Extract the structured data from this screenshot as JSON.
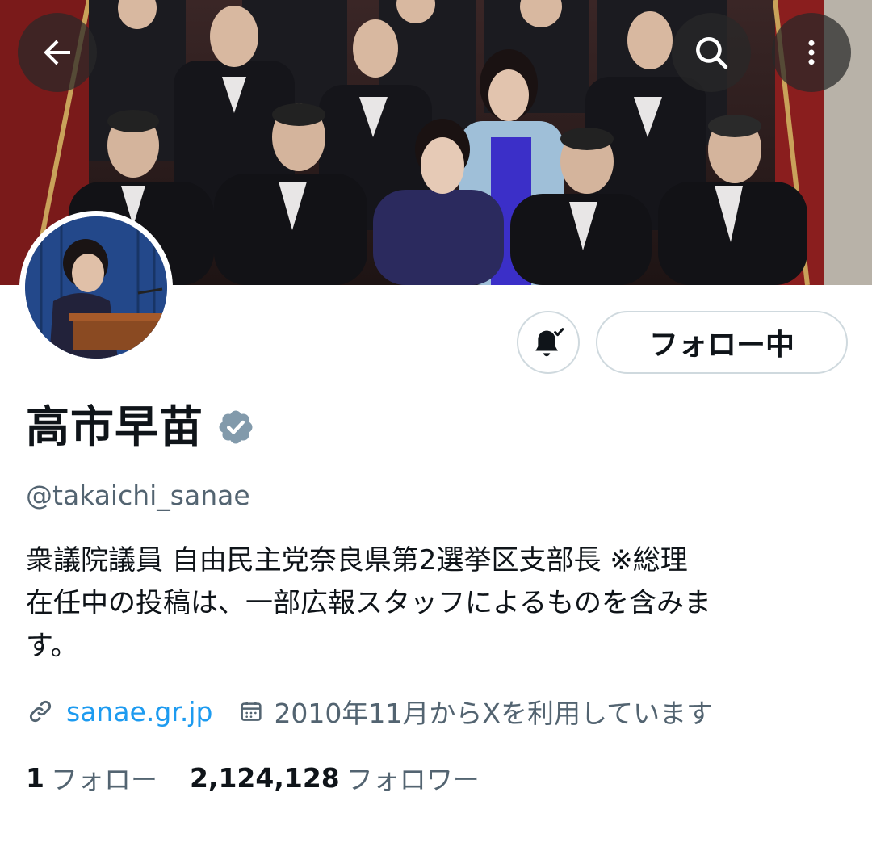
{
  "profile": {
    "display_name": "高市早苗",
    "handle": "@takaichi_sanae",
    "bio_lines": [
      "衆議院議員 自由民主党奈良県第2選挙区支部長 ※総理",
      "在任中の投稿は、一部広報スタッフによるものを含みま",
      "す。"
    ],
    "website": "sanae.gr.jp",
    "joined": "2010年11月からXを利用しています",
    "following_count": "1",
    "following_label": "フォロー",
    "followers_count": "2,124,128",
    "followers_label": "フォロワー"
  },
  "actions": {
    "follow_label": "フォロー中"
  },
  "icons": {
    "back": "arrow-left-icon",
    "search": "search-icon",
    "more": "more-vertical-icon",
    "notifications": "bell-check-icon",
    "verified": "verified-badge-icon",
    "link": "link-icon",
    "calendar": "calendar-icon"
  },
  "colors": {
    "link": "#1d9bf0",
    "secondary_text": "#536471",
    "primary_text": "#0f1419",
    "verified_badge": "#829aab",
    "button_border": "#cfd9de"
  }
}
